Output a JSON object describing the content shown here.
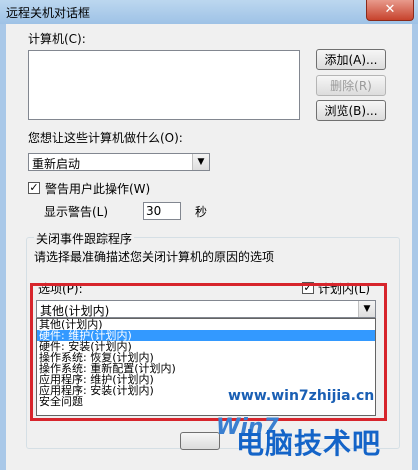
{
  "window": {
    "title": "远程关机对话框",
    "close_glyph": "✕"
  },
  "computers": {
    "label": "计算机(C):",
    "add_label": "添加(A)...",
    "remove_label": "删除(R)",
    "browse_label": "浏览(B)..."
  },
  "action": {
    "label": "您想让这些计算机做什么(O):",
    "selected": "重新启动"
  },
  "warn": {
    "checkbox_label": "警告用户此操作(W)",
    "checked": true,
    "display_label": "显示警告(L)",
    "seconds_value": "30",
    "seconds_unit": "秒"
  },
  "tracker": {
    "group_label": "关闭事件跟踪程序",
    "description": "请选择最准确描述您关闭计算机的原因的选项",
    "option_label": "选项(P):",
    "planned_label": "计划内(L)",
    "planned_checked": true,
    "selected_option": "其他(计划内)",
    "options": [
      "其他(计划内)",
      "硬件: 维护(计划内)",
      "硬件: 安装(计划内)",
      "操作系统: 恢复(计划内)",
      "操作系统: 重新配置(计划内)",
      "应用程序: 维护(计划内)",
      "应用程序: 安装(计划内)",
      "安全问题"
    ],
    "highlighted_index": 1
  },
  "watermark": {
    "url": "www.win7zhijia.cn",
    "brand": "电脑技术吧",
    "logo": "Win7"
  },
  "colors": {
    "highlight_border": "#d7252c",
    "selection": "#3399ff"
  }
}
